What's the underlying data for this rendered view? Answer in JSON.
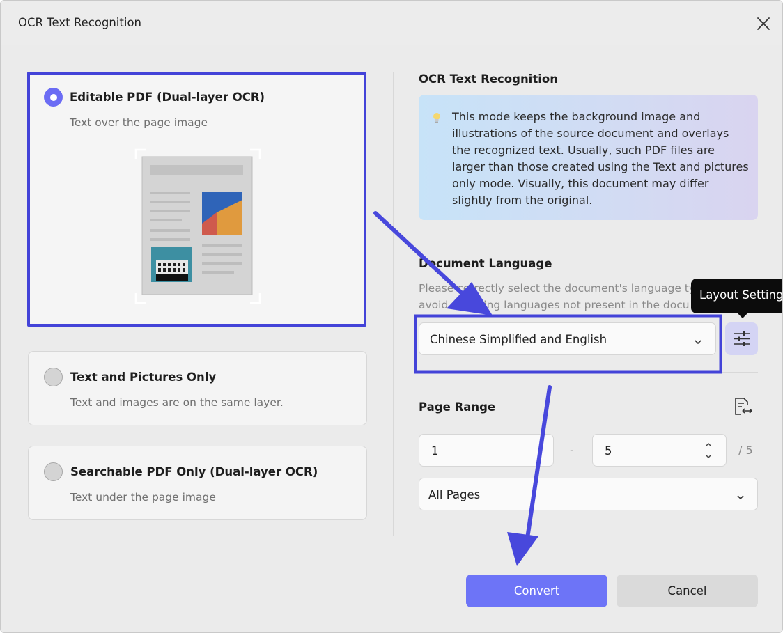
{
  "dialog": {
    "title": "OCR Text Recognition",
    "close_icon": "close-icon"
  },
  "options": [
    {
      "title": "Editable PDF (Dual-layer OCR)",
      "description": "Text over the page image",
      "selected": true
    },
    {
      "title": "Text and Pictures Only",
      "description": "Text and images are on the same layer.",
      "selected": false
    },
    {
      "title": "Searchable PDF Only (Dual-layer OCR)",
      "description": "Text under the page image",
      "selected": false
    }
  ],
  "ocr_section": {
    "title": "OCR Text Recognition",
    "info_icon": "lightbulb-icon",
    "info_text": "This mode keeps the background image and illustrations of the source document and overlays the recognized text. Usually, such PDF files are larger than those created using the Text and pictures only mode. Visually, this document may differ slightly from the original."
  },
  "language": {
    "title": "Document Language",
    "hint_line1": "Please correctly select the document's language ty",
    "hint_line2": "avoid selecting languages not present in the docu",
    "selected": "Chinese Simplified and English",
    "layout_tooltip": "Layout Settings",
    "layout_icon": "sliders-icon"
  },
  "page_range": {
    "title": "Page Range",
    "from": "1",
    "to": "5",
    "separator": "-",
    "total": "/ 5",
    "scope": "All Pages",
    "icon": "page-swap-icon"
  },
  "buttons": {
    "convert": "Convert",
    "cancel": "Cancel"
  },
  "colors": {
    "accent": "#6d74f7",
    "highlight_border": "#4343d8",
    "arrow": "#4848dc"
  }
}
